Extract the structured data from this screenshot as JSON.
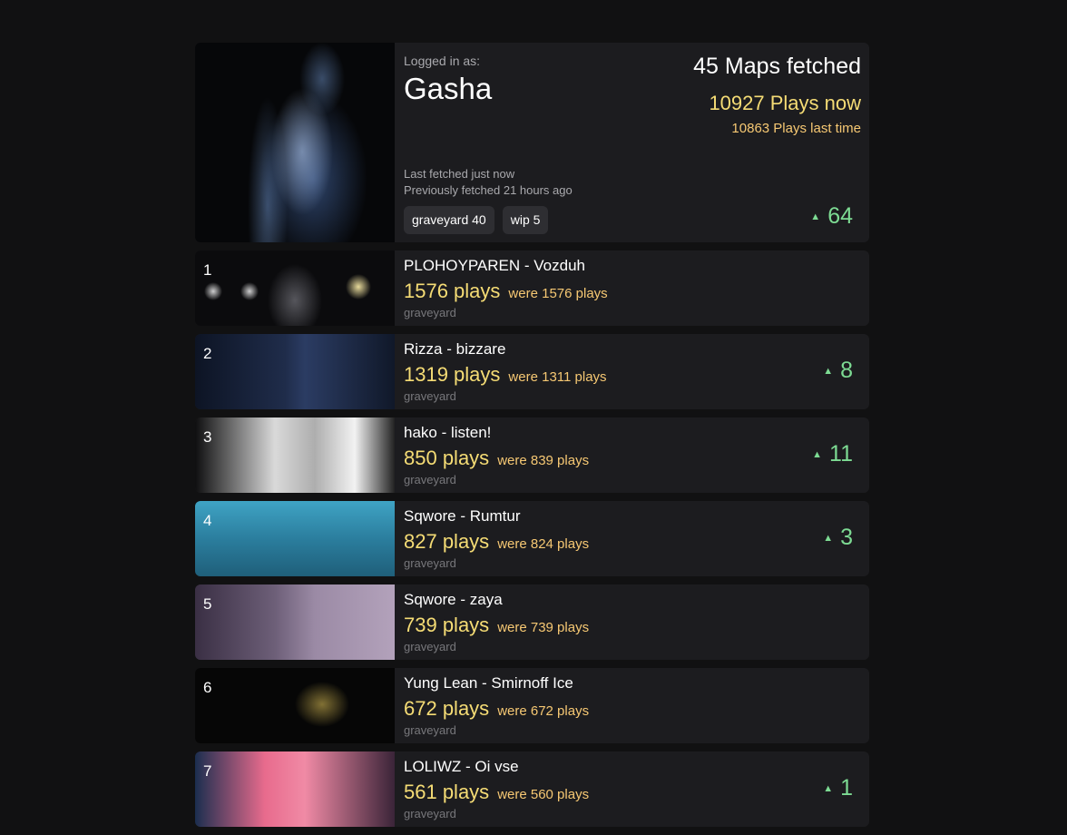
{
  "profile": {
    "logged_in_label": "Logged in as:",
    "username": "Gasha",
    "maps_fetched": "45 Maps fetched",
    "plays_now": "10927 Plays now",
    "plays_last": "10863 Plays last time",
    "last_fetched": "Last fetched just now",
    "previously_fetched": "Previously fetched 21 hours ago",
    "tags": [
      "graveyard 40",
      "wip 5"
    ],
    "delta": "64"
  },
  "maps": [
    {
      "rank": "1",
      "title": "PLOHOYPAREN - Vozduh",
      "plays": "1576 plays",
      "were": "were 1576 plays",
      "status": "graveyard",
      "delta": ""
    },
    {
      "rank": "2",
      "title": "Rizza - bizzare",
      "plays": "1319 plays",
      "were": "were 1311 plays",
      "status": "graveyard",
      "delta": "8"
    },
    {
      "rank": "3",
      "title": "hako - listen!",
      "plays": "850 plays",
      "were": "were 839 plays",
      "status": "graveyard",
      "delta": "11"
    },
    {
      "rank": "4",
      "title": "Sqwore - Rumtur",
      "plays": "827 plays",
      "were": "were 824 plays",
      "status": "graveyard",
      "delta": "3"
    },
    {
      "rank": "5",
      "title": "Sqwore - zaya",
      "plays": "739 plays",
      "were": "were 739 plays",
      "status": "graveyard",
      "delta": ""
    },
    {
      "rank": "6",
      "title": "Yung Lean - Smirnoff Ice",
      "plays": "672 plays",
      "were": "were 672 plays",
      "status": "graveyard",
      "delta": ""
    },
    {
      "rank": "7",
      "title": "LOLIWZ - Oi vse",
      "plays": "561 plays",
      "were": "were 560 plays",
      "status": "graveyard",
      "delta": "1"
    }
  ],
  "icons": {
    "delta_up": "triangle-up-icon"
  },
  "colors": {
    "background": "#111112",
    "card": "#1c1c1f",
    "plays": "#f5dc75",
    "positive": "#7ddb93"
  }
}
